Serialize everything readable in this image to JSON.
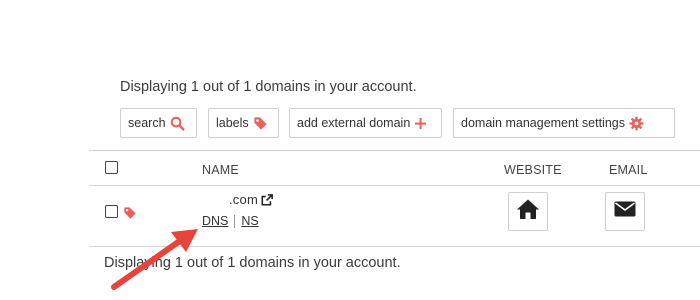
{
  "summary": {
    "top": "Displaying 1 out of 1 domains in your account.",
    "bottom": "Displaying 1 out of 1 domains in your account."
  },
  "toolbar": {
    "search": "search",
    "labels": "labels",
    "add_external": "add external domain",
    "settings": "domain management settings"
  },
  "table": {
    "headers": {
      "name": "NAME",
      "website": "WEBSITE",
      "email": "EMAIL"
    },
    "rows": [
      {
        "domain_suffix": ".com",
        "dns": "DNS",
        "ns": "NS"
      }
    ]
  },
  "icons": {
    "search": "magnifier-icon",
    "label": "tag-icon",
    "add": "plus-icon",
    "settings": "gear-icon",
    "external_link": "external-link-icon",
    "website": "home-icon",
    "email": "envelope-icon",
    "pointer": "red-arrow-annotation"
  },
  "colors": {
    "accent": "#e8615a",
    "annotation": "#e8443c",
    "text": "#3b3b3b",
    "border": "#cfcfcf"
  }
}
